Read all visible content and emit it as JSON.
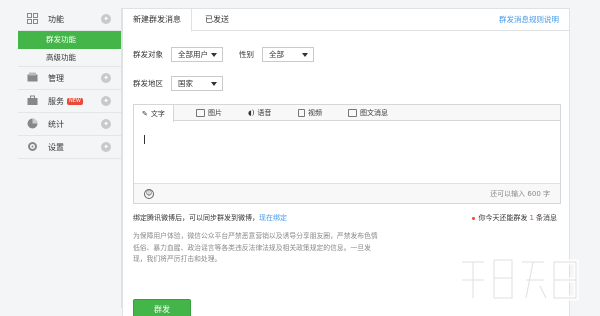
{
  "sidebar": {
    "items": [
      {
        "label": "功能",
        "icon": "grid-icon"
      },
      {
        "label": "管理",
        "icon": "tray-icon"
      },
      {
        "label": "服务",
        "icon": "briefcase-icon",
        "badge": "NEW"
      },
      {
        "label": "统计",
        "icon": "pie-chart-icon"
      },
      {
        "label": "设置",
        "icon": "settings-icon"
      }
    ],
    "sub_items": [
      {
        "label": "群发功能",
        "active": true
      },
      {
        "label": "高级功能",
        "active": false
      }
    ]
  },
  "tabs": {
    "new_message": "新建群发消息",
    "sent": "已发送",
    "rules_link": "群发消息规则说明"
  },
  "form": {
    "target_label": "群发对象",
    "target_value": "全部用户",
    "gender_label": "性别",
    "gender_value": "全部",
    "region_label": "群发地区",
    "region_value": "国家"
  },
  "editor": {
    "tabs": [
      "文字",
      "图片",
      "语音",
      "视频",
      "图文消息"
    ],
    "remaining": "还可以输入 600 字"
  },
  "notice": {
    "bind_text": "绑定腾讯微博后，可以同步群发到微博，",
    "bind_link": "现在绑定",
    "quota_prefix": "你今天还能群发",
    "quota_count": "1",
    "quota_suffix": "条消息",
    "policy": "为保障用户体验，微信公众平台严禁恶意营销以及诱导分享朋友圈，严禁发布色情低俗、暴力血腥、政治谣言等各类违反法律法规及相关政策规定的信息。一旦发现，我们将严厉打击和处理。"
  },
  "actions": {
    "send": "群发"
  },
  "colors": {
    "accent": "#44b549",
    "link": "#459ae9",
    "alert": "#e94a3b"
  }
}
